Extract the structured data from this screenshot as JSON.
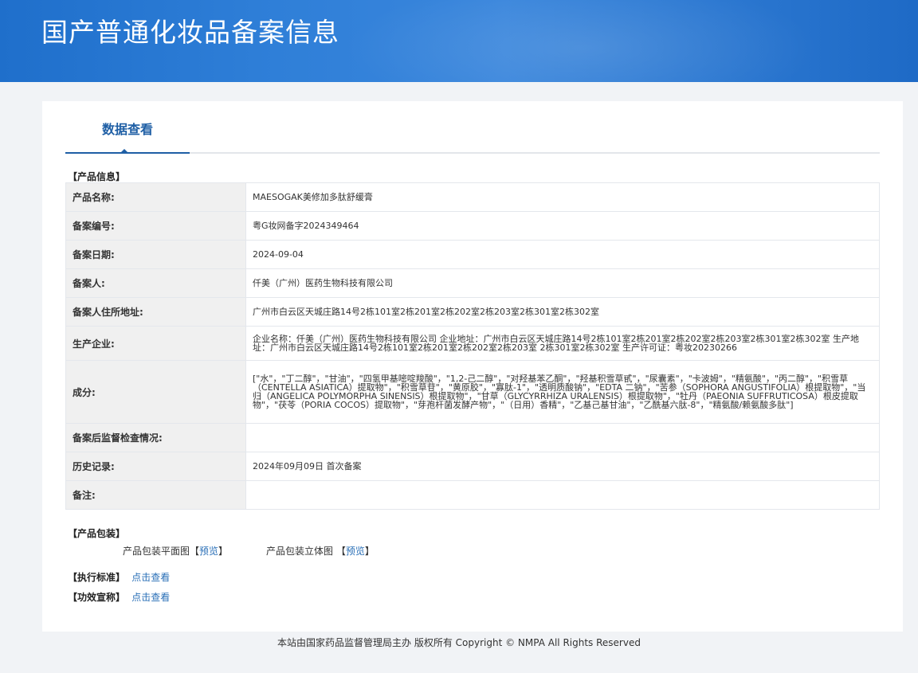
{
  "header": {
    "title": "国产普通化妆品备案信息"
  },
  "tab": {
    "label": "数据查看"
  },
  "sections": {
    "product_info": "【产品信息】",
    "product_package": "【产品包装】",
    "standard": "【执行标准】",
    "efficacy": "【功效宣称】"
  },
  "info": {
    "product_name_label": "产品名称:",
    "product_name": "MAESOGAK美修加多肽舒缓膏",
    "record_no_label": "备案编号:",
    "record_no": "粤G妆网备字2024349464",
    "record_date_label": "备案日期:",
    "record_date": "2024-09-04",
    "registrant_label": "备案人:",
    "registrant": "仟美（广州）医药生物科技有限公司",
    "address_label": "备案人住所地址:",
    "address": "广州市白云区天城庄路14号2栋101室2栋201室2栋202室2栋203室2栋301室2栋302室",
    "manufacturer_label": "生产企业:",
    "manufacturer": "企业名称：仟美（广州）医药生物科技有限公司 企业地址：广州市白云区天城庄路14号2栋101室2栋201室2栋202室2栋203室2栋301室2栋302室 生产地址：广州市白云区天城庄路14号2栋101室2栋201室2栋202室2栋203室 2栋301室2栋302室 生产许可证：粤妆20230266",
    "ingredients_label": "成分:",
    "ingredients": "[\"水\"，\"丁二醇\"，\"甘油\"，\"四氢甲基嘧啶羧酸\"，\"1,2-己二醇\"，\"对羟基苯乙酮\"，\"羟基积雪草甙\"，\"尿囊素\"，\"卡波姆\"，\"精氨酸\"，\"丙二醇\"，\"积雪草（CENTELLA ASIATICA）提取物\"，\"积雪草苷\"，\"黄原胶\"，\"寡肽-1\"，\"透明质酸钠\"，\"EDTA 二钠\"，\"苦参（SOPHORA ANGUSTIFOLIA）根提取物\"，\"当归（ANGELICA POLYMORPHA SINENSIS）根提取物\"，\"甘草（GLYCYRRHIZA URALENSIS）根提取物\"，\"牡丹（PAEONIA SUFFRUTICOSA）根皮提取物\"，\"茯苓（PORIA COCOS）提取物\"，\"芽孢杆菌发酵产物\"，\"（日用）香精\"，\"乙基己基甘油\"，\"乙酰基六肽-8\"，\"精氨酸/赖氨酸多肽\"]",
    "inspection_label": "备案后监督检查情况:",
    "inspection": "",
    "history_label": "历史记录:",
    "history": "2024年09月09日 首次备案",
    "remark_label": "备注:",
    "remark": ""
  },
  "package": {
    "flat_label": "产品包装平面图",
    "flat_link": "预览",
    "solid_label": "产品包装立体图",
    "solid_link": "预览",
    "bracket_open": "【",
    "bracket_close": "】"
  },
  "standard_link": "点击查看",
  "efficacy_link": "点击查看",
  "footer": {
    "text": "本站由国家药品监督管理局主办 版权所有 Copyright © NMPA All Rights Reserved"
  }
}
